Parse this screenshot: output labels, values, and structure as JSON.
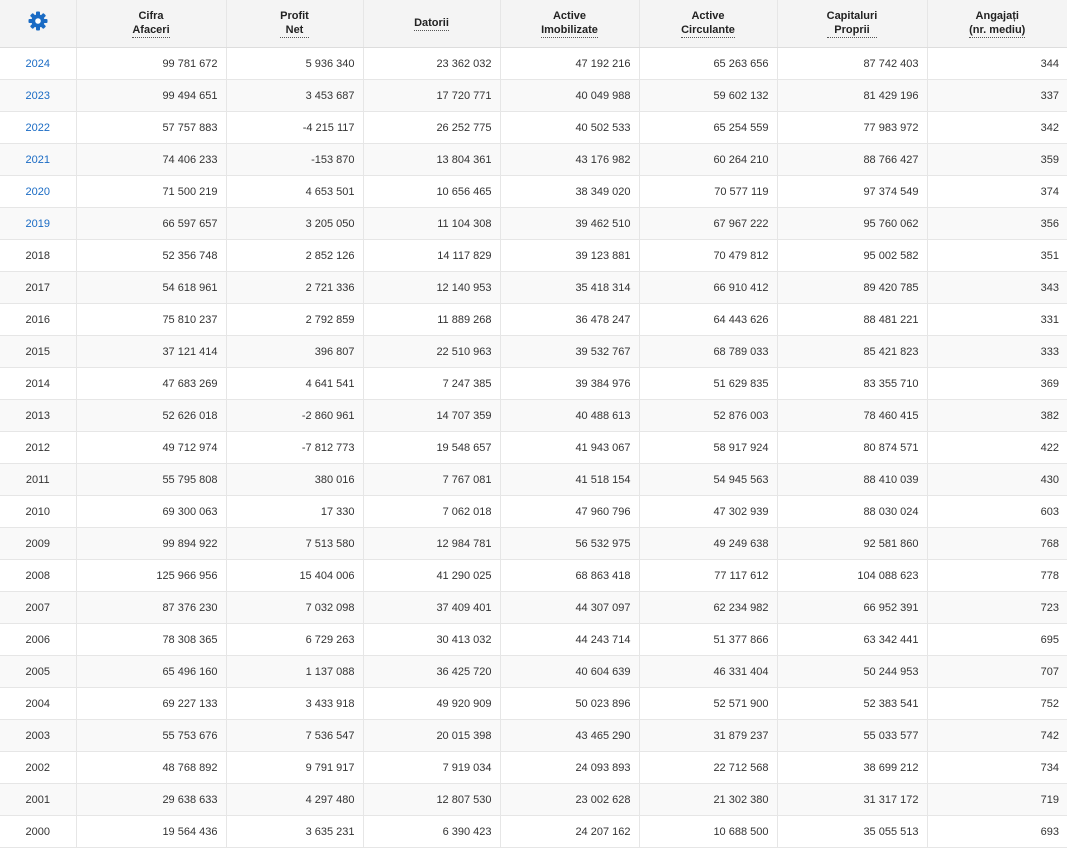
{
  "settings": {
    "icon": "gear-icon",
    "color": "#1a6bc4"
  },
  "headers": [
    {
      "line1": "Cifra",
      "line2": "Afaceri"
    },
    {
      "line1": "Profit",
      "line2": "Net"
    },
    {
      "line1": "Datorii",
      "line2": ""
    },
    {
      "line1": "Active",
      "line2": "Imobilizate"
    },
    {
      "line1": "Active",
      "line2": "Circulante"
    },
    {
      "line1": "Capitaluri",
      "line2": "Proprii"
    },
    {
      "line1": "Angajați",
      "line2": "(nr. mediu)"
    }
  ],
  "rows": [
    {
      "year": "2024",
      "link": true,
      "values": [
        "99 781 672",
        "5 936 340",
        "23 362 032",
        "47 192 216",
        "65 263 656",
        "87 742 403",
        "344"
      ]
    },
    {
      "year": "2023",
      "link": true,
      "values": [
        "99 494 651",
        "3 453 687",
        "17 720 771",
        "40 049 988",
        "59 602 132",
        "81 429 196",
        "337"
      ]
    },
    {
      "year": "2022",
      "link": true,
      "values": [
        "57 757 883",
        "-4 215 117",
        "26 252 775",
        "40 502 533",
        "65 254 559",
        "77 983 972",
        "342"
      ]
    },
    {
      "year": "2021",
      "link": true,
      "values": [
        "74 406 233",
        "-153 870",
        "13 804 361",
        "43 176 982",
        "60 264 210",
        "88 766 427",
        "359"
      ]
    },
    {
      "year": "2020",
      "link": true,
      "values": [
        "71 500 219",
        "4 653 501",
        "10 656 465",
        "38 349 020",
        "70 577 119",
        "97 374 549",
        "374"
      ]
    },
    {
      "year": "2019",
      "link": true,
      "values": [
        "66 597 657",
        "3 205 050",
        "11 104 308",
        "39 462 510",
        "67 967 222",
        "95 760 062",
        "356"
      ]
    },
    {
      "year": "2018",
      "link": false,
      "values": [
        "52 356 748",
        "2 852 126",
        "14 117 829",
        "39 123 881",
        "70 479 812",
        "95 002 582",
        "351"
      ]
    },
    {
      "year": "2017",
      "link": false,
      "values": [
        "54 618 961",
        "2 721 336",
        "12 140 953",
        "35 418 314",
        "66 910 412",
        "89 420 785",
        "343"
      ]
    },
    {
      "year": "2016",
      "link": false,
      "values": [
        "75 810 237",
        "2 792 859",
        "11 889 268",
        "36 478 247",
        "64 443 626",
        "88 481 221",
        "331"
      ]
    },
    {
      "year": "2015",
      "link": false,
      "values": [
        "37 121 414",
        "396 807",
        "22 510 963",
        "39 532 767",
        "68 789 033",
        "85 421 823",
        "333"
      ]
    },
    {
      "year": "2014",
      "link": false,
      "values": [
        "47 683 269",
        "4 641 541",
        "7 247 385",
        "39 384 976",
        "51 629 835",
        "83 355 710",
        "369"
      ]
    },
    {
      "year": "2013",
      "link": false,
      "values": [
        "52 626 018",
        "-2 860 961",
        "14 707 359",
        "40 488 613",
        "52 876 003",
        "78 460 415",
        "382"
      ]
    },
    {
      "year": "2012",
      "link": false,
      "values": [
        "49 712 974",
        "-7 812 773",
        "19 548 657",
        "41 943 067",
        "58 917 924",
        "80 874 571",
        "422"
      ]
    },
    {
      "year": "2011",
      "link": false,
      "values": [
        "55 795 808",
        "380 016",
        "7 767 081",
        "41 518 154",
        "54 945 563",
        "88 410 039",
        "430"
      ]
    },
    {
      "year": "2010",
      "link": false,
      "values": [
        "69 300 063",
        "17 330",
        "7 062 018",
        "47 960 796",
        "47 302 939",
        "88 030 024",
        "603"
      ]
    },
    {
      "year": "2009",
      "link": false,
      "values": [
        "99 894 922",
        "7 513 580",
        "12 984 781",
        "56 532 975",
        "49 249 638",
        "92 581 860",
        "768"
      ]
    },
    {
      "year": "2008",
      "link": false,
      "values": [
        "125 966 956",
        "15 404 006",
        "41 290 025",
        "68 863 418",
        "77 117 612",
        "104 088 623",
        "778"
      ]
    },
    {
      "year": "2007",
      "link": false,
      "values": [
        "87 376 230",
        "7 032 098",
        "37 409 401",
        "44 307 097",
        "62 234 982",
        "66 952 391",
        "723"
      ]
    },
    {
      "year": "2006",
      "link": false,
      "values": [
        "78 308 365",
        "6 729 263",
        "30 413 032",
        "44 243 714",
        "51 377 866",
        "63 342 441",
        "695"
      ]
    },
    {
      "year": "2005",
      "link": false,
      "values": [
        "65 496 160",
        "1 137 088",
        "36 425 720",
        "40 604 639",
        "46 331 404",
        "50 244 953",
        "707"
      ]
    },
    {
      "year": "2004",
      "link": false,
      "values": [
        "69 227 133",
        "3 433 918",
        "49 920 909",
        "50 023 896",
        "52 571 900",
        "52 383 541",
        "752"
      ]
    },
    {
      "year": "2003",
      "link": false,
      "values": [
        "55 753 676",
        "7 536 547",
        "20 015 398",
        "43 465 290",
        "31 879 237",
        "55 033 577",
        "742"
      ]
    },
    {
      "year": "2002",
      "link": false,
      "values": [
        "48 768 892",
        "9 791 917",
        "7 919 034",
        "24 093 893",
        "22 712 568",
        "38 699 212",
        "734"
      ]
    },
    {
      "year": "2001",
      "link": false,
      "values": [
        "29 638 633",
        "4 297 480",
        "12 807 530",
        "23 002 628",
        "21 302 380",
        "31 317 172",
        "719"
      ]
    },
    {
      "year": "2000",
      "link": false,
      "values": [
        "19 564 436",
        "3 635 231",
        "6 390 423",
        "24 207 162",
        "10 688 500",
        "35 055 513",
        "693"
      ]
    }
  ]
}
